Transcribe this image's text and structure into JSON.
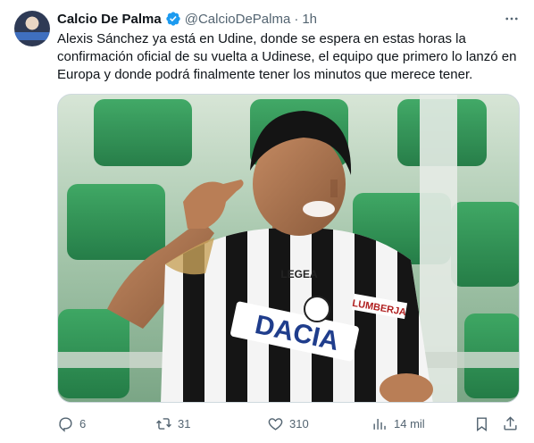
{
  "tweet": {
    "author_name": "Calcio De Palma",
    "handle": "@CalcioDePalma",
    "separator": "·",
    "time": "1h",
    "text": "Alexis Sánchez ya está en Udine, donde se espera en estas horas la confirmación oficial de su vuelta a Udinese, el equipo que primero lo lanzó en Europa y donde podrá finalmente tener los minutos que merece tener."
  },
  "media": {
    "sponsor_text": "DACIA",
    "brand_text": "LEGEA",
    "secondary_sponsor": "LUMBERJA"
  },
  "actions": {
    "replies": "6",
    "reposts": "31",
    "likes": "310",
    "views": "14 mil"
  },
  "colors": {
    "text": "#0f1419",
    "secondary": "#536471",
    "verified": "#1d9bf0",
    "border": "#cfd9de"
  }
}
